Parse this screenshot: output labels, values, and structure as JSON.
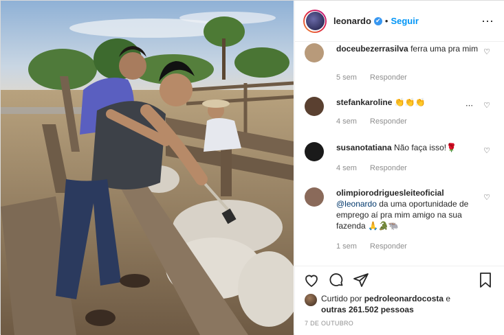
{
  "post": {
    "username": "leonardo",
    "verified_badge": "✔",
    "separator": "•",
    "follow_label": "Seguir",
    "more_icon": "⋯",
    "comments": [
      {
        "user": "doceubezerrasilva",
        "text": "ferra uma pra mim",
        "time": "5 sem",
        "reply": "Responder",
        "avatar_color": "#b89a7a"
      },
      {
        "user": "stefankaroline",
        "text": "👏👏👏",
        "time": "4 sem",
        "reply": "Responder",
        "avatar_color": "#5a4030",
        "more": "⋯"
      },
      {
        "user": "susanotatiana",
        "text": "Não faça isso!🌹",
        "time": "4 sem",
        "reply": "Responder",
        "avatar_color": "#1a1a1a"
      },
      {
        "user": "olimpiorodriguesleiteoficial",
        "mention": "@leonardo",
        "text": "da uma oportunidade de emprego aí pra mim amigo na sua fazenda 🙏🐊🐃",
        "time": "1 sem",
        "reply": "Responder",
        "avatar_color": "#8a6a5a"
      }
    ],
    "likes": {
      "prefix": "Curtido por",
      "liker": "pedroleonardocosta",
      "middle": "e",
      "others": "outras 261.502 pessoas"
    },
    "date": "7 DE OUTUBRO",
    "icons": {
      "like": "heart-icon",
      "comment": "comment-icon",
      "share": "share-icon",
      "save": "bookmark-icon"
    }
  }
}
